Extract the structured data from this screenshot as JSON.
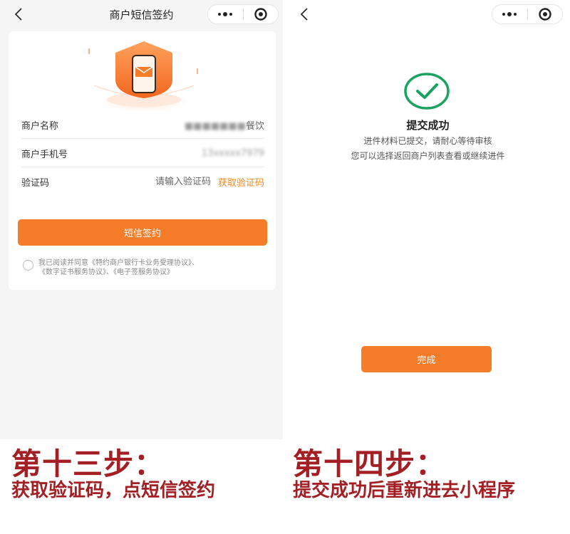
{
  "left": {
    "nav_title": "商户短信签约",
    "form": {
      "merchant_name_label": "商户名称",
      "merchant_name_value_hidden": "■■■■■■■",
      "merchant_name_value_suffix": "餐饮",
      "merchant_phone_label": "商户手机号",
      "merchant_phone_value_hidden": "13xxxxx7979",
      "code_label": "验证码",
      "code_placeholder": "请输入验证码",
      "get_code_label": "获取验证码"
    },
    "sign_button_label": "短信签约",
    "agreement": {
      "prefix": "我已阅读并同意",
      "link1": "《特约商户银行卡业务受理协议》",
      "sep1": "、",
      "link2": "《数字证书服务协议》",
      "sep2": "、",
      "link3": "《电子签服务协议》"
    }
  },
  "right": {
    "title": "提交成功",
    "message_line1": "进件材料已提交，请耐心等待审核",
    "message_line2": "您可以选择返回商户列表查看或继续进件",
    "done_button_label": "完成"
  },
  "captions": {
    "left_step": "第十三步：",
    "left_desc": "获取验证码，点短信签约",
    "right_step": "第十四步：",
    "right_desc": "提交成功后重新进去小程序"
  },
  "colors": {
    "accent": "#f57c29",
    "link_orange": "#f08a24",
    "success_green": "#1aa260",
    "caption_red": "#a31f24"
  },
  "icons": {
    "back": "chevron-left-icon",
    "more": "more-dots-icon",
    "record": "target-circle-icon",
    "hero": "shield-phone-icon",
    "success": "check-circle-icon",
    "radio": "radio-circle-icon"
  }
}
